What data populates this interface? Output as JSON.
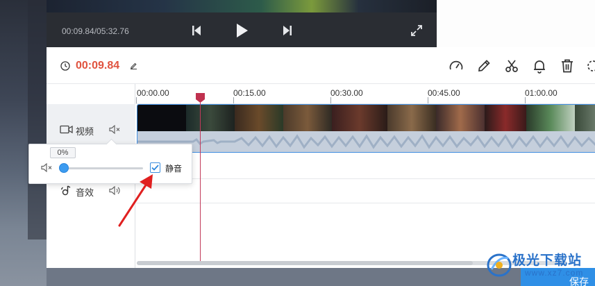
{
  "player": {
    "time_readout": "00:09.84/05:32.76",
    "icons": [
      "prev-frame-icon",
      "play-icon",
      "next-frame-icon",
      "fullscreen-icon"
    ]
  },
  "toolbar": {
    "current_time": "00:09.84",
    "tools": [
      "speed-icon",
      "pencil-icon",
      "scissors-icon",
      "bell-icon",
      "trash-icon",
      "crop-icon"
    ]
  },
  "tracks": {
    "video_label": "视频",
    "sound_label": "音效"
  },
  "ruler": {
    "labels": [
      "00:00.00",
      "00:15.00",
      "00:30.00",
      "00:45.00",
      "01:00.00"
    ]
  },
  "volume_popover": {
    "percent": "0%",
    "level": 0,
    "mute_label": "静音",
    "mute_checked": true
  },
  "bottom": {
    "button_text": "保存"
  },
  "watermark": {
    "title": "极光下载站",
    "subtitle": "www.xz7.com"
  },
  "colors": {
    "accent_blue": "#2f8fe6",
    "time_red": "#e0533f",
    "playhead": "#c0314f",
    "annotation_arrow": "#e02020"
  }
}
